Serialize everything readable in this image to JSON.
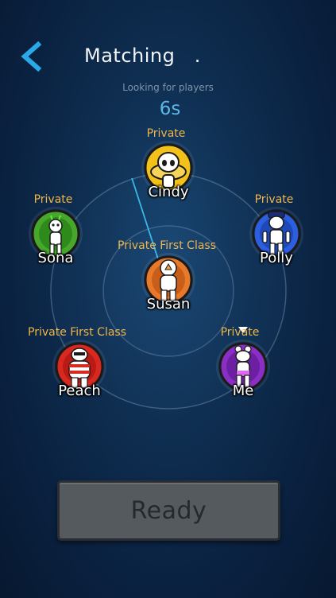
{
  "header": {
    "title": "Matching   .",
    "back_icon": "chevron-left-icon",
    "accent_color": "#2aa9e8"
  },
  "status": {
    "subtitle": "Looking for players",
    "countdown": "6s"
  },
  "players": [
    {
      "id": "cindy",
      "rank": "Private",
      "name": "Cindy",
      "avatar_icon": "alien-avatar-icon",
      "ring_color": "#f3c21a"
    },
    {
      "id": "sona",
      "rank": "Private",
      "name": "Sona",
      "avatar_icon": "green-alien-avatar-icon",
      "ring_color": "#46a72b"
    },
    {
      "id": "polly",
      "rank": "Private",
      "name": "Polly",
      "avatar_icon": "police-avatar-icon",
      "ring_color": "#2b5fe0"
    },
    {
      "id": "susan",
      "rank": "Private  First  Class",
      "name": "Susan",
      "avatar_icon": "astronaut-avatar-icon",
      "ring_color": "#e8792a"
    },
    {
      "id": "peach",
      "rank": "Private  First  Class",
      "name": "Peach",
      "avatar_icon": "striped-avatar-icon",
      "ring_color": "#d8281f"
    },
    {
      "id": "me",
      "rank": "Private",
      "name": "Me",
      "avatar_icon": "purple-avatar-icon",
      "ring_color": "#8a2fc4"
    }
  ],
  "ready_button": {
    "label": "Ready"
  }
}
